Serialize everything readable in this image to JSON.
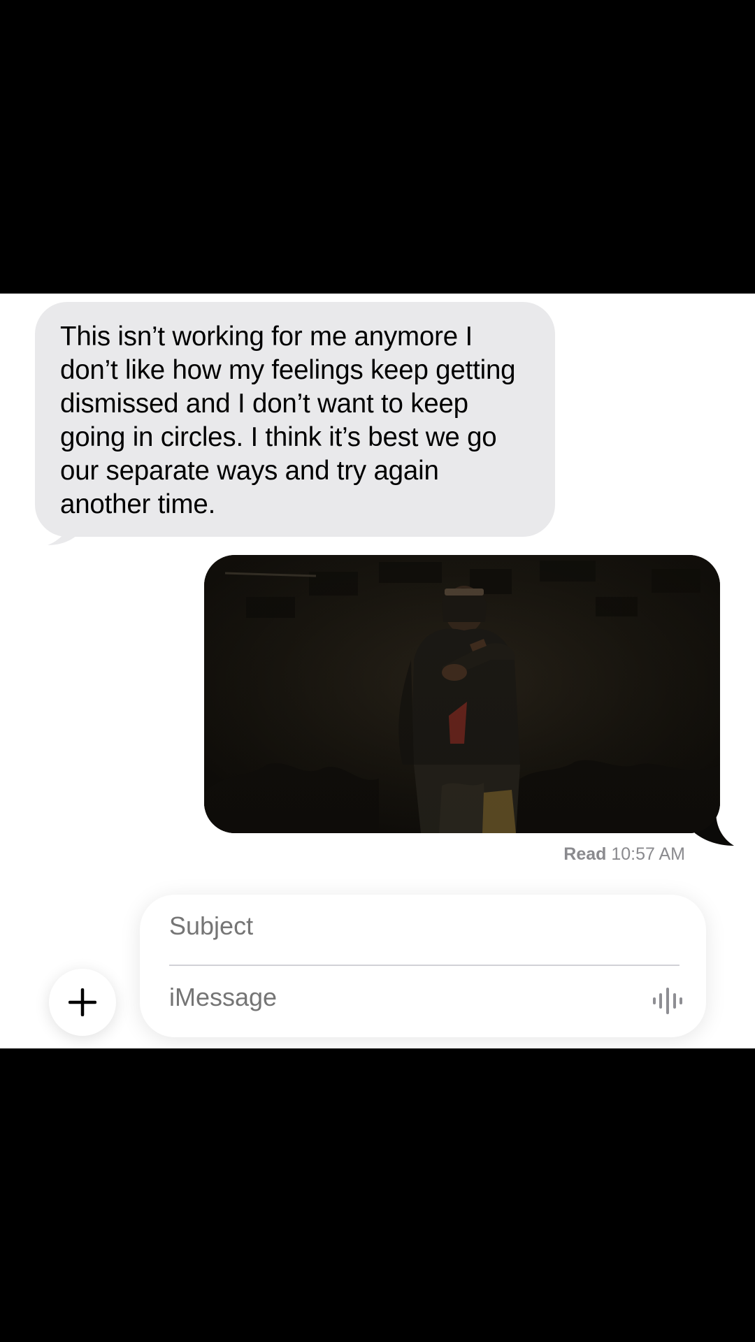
{
  "conversation": {
    "incoming_message": {
      "text": "This isn’t working for me anymore I don’t like how my feelings keep getting dismissed and I don’t want to keep going in circles. I think it’s best we go our separate ways and try again another time."
    },
    "outgoing_media": {
      "type": "image"
    },
    "receipt": {
      "label": "Read",
      "time": "10:57 AM"
    }
  },
  "compose": {
    "subject_placeholder": "Subject",
    "message_placeholder": "iMessage",
    "plus_icon": "plus-icon",
    "dictation_icon": "waveform-icon"
  },
  "colors": {
    "incoming_bubble": "#e9e9eb",
    "background": "#ffffff",
    "letterbox": "#000000",
    "receipt_text": "#8a8a8e",
    "placeholder_text": "#b3b3b7"
  }
}
